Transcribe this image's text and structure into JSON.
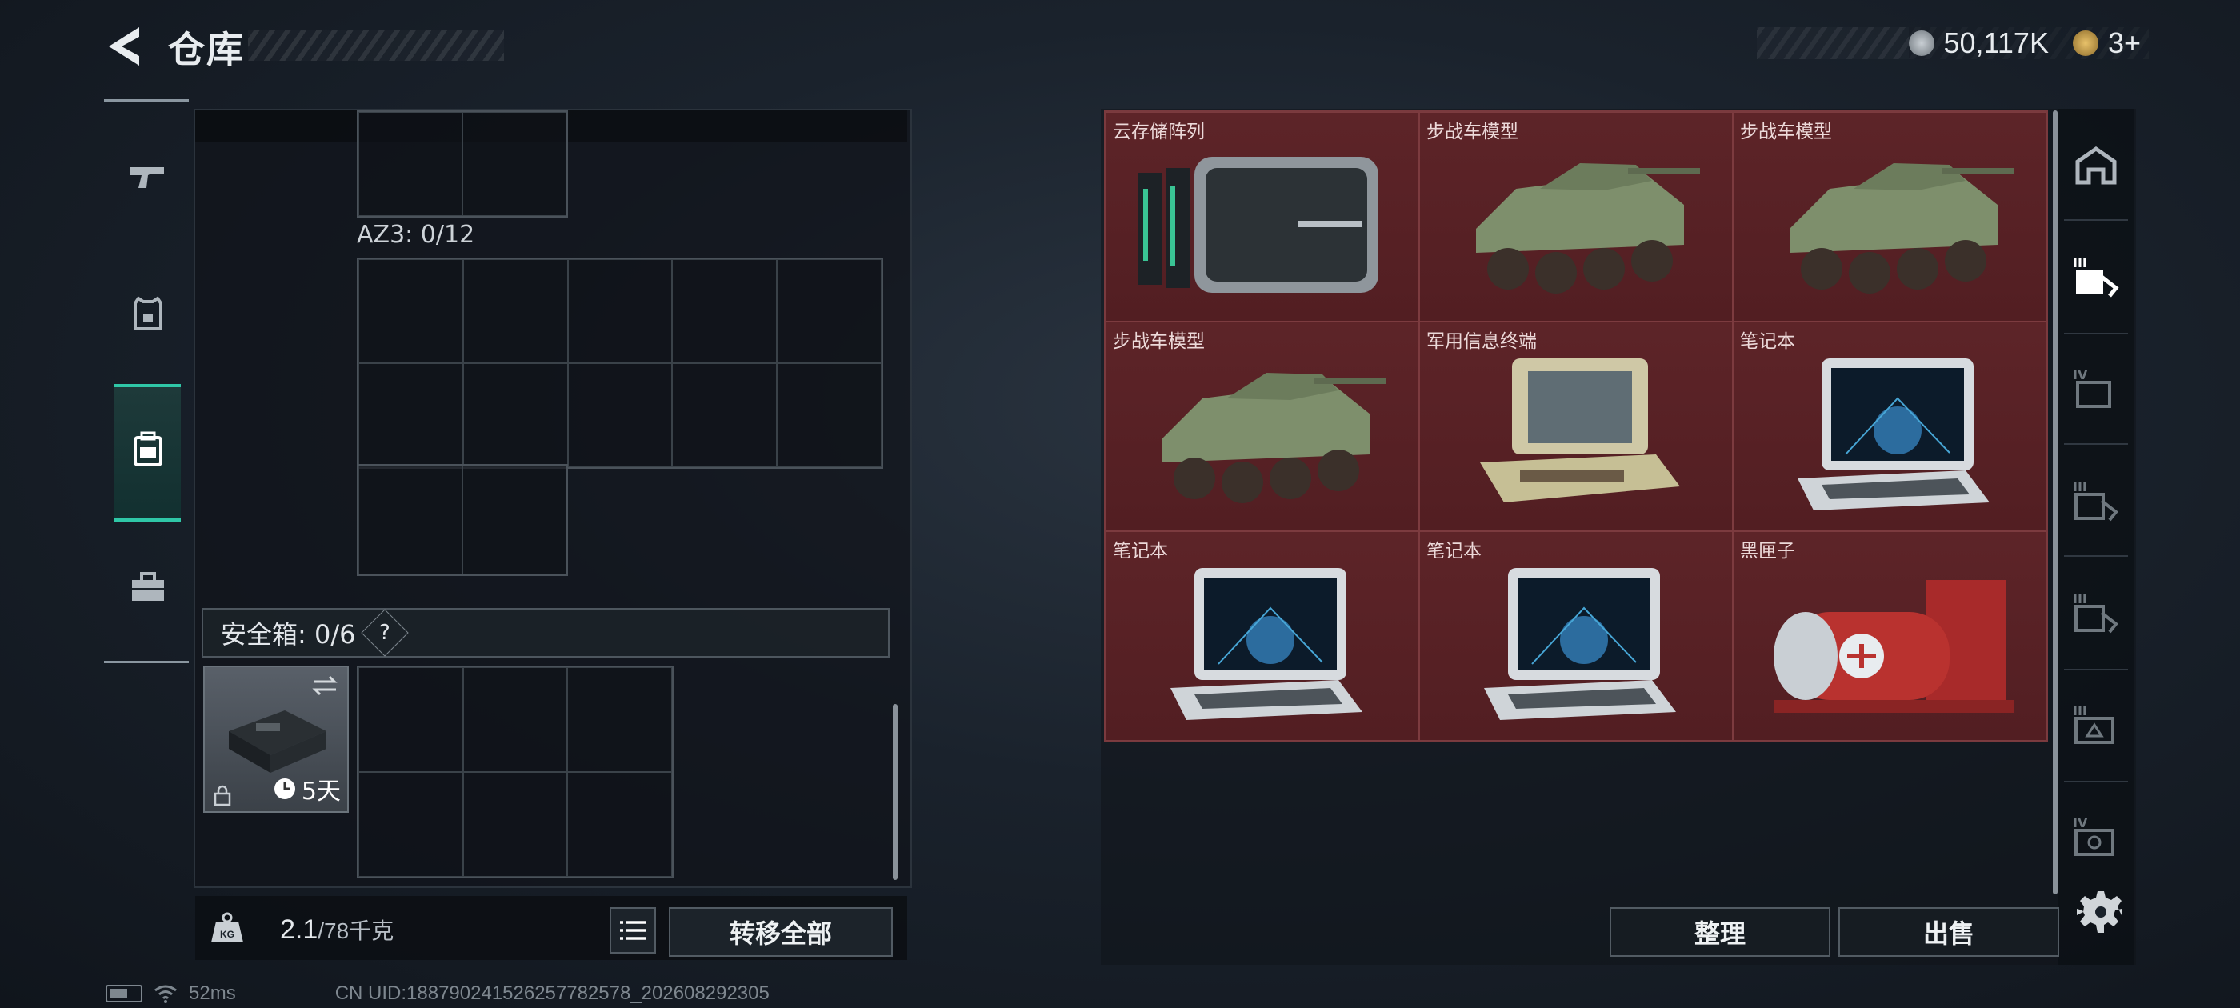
{
  "header": {
    "title": "仓库",
    "back_icon": "back-arrow-icon"
  },
  "currency": {
    "coins": "50,117K",
    "tickets": "3+",
    "coin_icon": "coin-icon",
    "ticket_icon": "ticket-icon"
  },
  "sidebar": [
    {
      "name": "weapons",
      "icon": "pistol-icon"
    },
    {
      "name": "armor",
      "icon": "armor-icon"
    },
    {
      "name": "backpack",
      "icon": "backpack-icon",
      "active": true
    },
    {
      "name": "toolbox",
      "icon": "toolbox-icon"
    }
  ],
  "inventory": {
    "az3_label": "AZ3: 0/12",
    "safe_label": "安全箱: 0/6",
    "safe_help": "?",
    "case_timer": "5天",
    "weight_value": "2.1",
    "weight_max": "/78千克",
    "transfer_all": "转移全部"
  },
  "storage": {
    "items": [
      {
        "name": "云存储阵列",
        "icon": "server-array-icon"
      },
      {
        "name": "步战车模型",
        "icon": "ifv-model-icon"
      },
      {
        "name": "步战车模型",
        "icon": "ifv-model-icon"
      },
      {
        "name": "步战车模型",
        "icon": "ifv-model-icon"
      },
      {
        "name": "军用信息终端",
        "icon": "military-terminal-icon"
      },
      {
        "name": "笔记本",
        "icon": "laptop-icon"
      },
      {
        "name": "笔记本",
        "icon": "laptop-icon"
      },
      {
        "name": "笔记本",
        "icon": "laptop-icon"
      },
      {
        "name": "黑匣子",
        "icon": "black-box-icon"
      }
    ],
    "sort_label": "整理",
    "sell_label": "出售",
    "tabs": [
      "tab-home",
      "tab-iii-a",
      "tab-iv-a",
      "tab-iii-b",
      "tab-iii-c",
      "tab-iii-d",
      "tab-iv-b"
    ]
  },
  "status": {
    "ping": "52ms",
    "uid": "CN UID:18879024152625778257­8_202608292305"
  },
  "colors": {
    "accent": "#2fc7a7",
    "storage_cell": "#5a2226"
  }
}
